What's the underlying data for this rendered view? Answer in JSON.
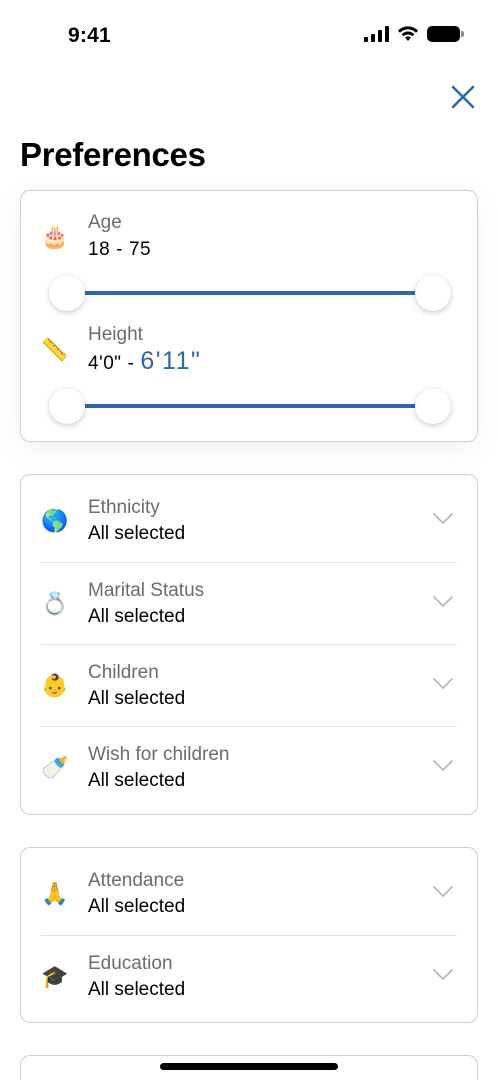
{
  "status_bar": {
    "time": "9:41"
  },
  "header": {
    "title": "Preferences"
  },
  "ranges": [
    {
      "label": "Age",
      "icon": "🎂",
      "icon_name": "birthday-cake-icon",
      "low": "18",
      "separator": "-",
      "high": "75"
    },
    {
      "label": "Height",
      "icon": "📏",
      "icon_name": "ruler-icon",
      "low": "4'0\"",
      "separator": "-",
      "high": "6'11\""
    }
  ],
  "filters_group_1": [
    {
      "label": "Ethnicity",
      "value": "All selected",
      "icon": "🌎",
      "icon_name": "globe-icon"
    },
    {
      "label": "Marital Status",
      "value": "All selected",
      "icon": "💍",
      "icon_name": "ring-icon"
    },
    {
      "label": "Children",
      "value": "All selected",
      "icon": "👶",
      "icon_name": "baby-icon"
    },
    {
      "label": "Wish for children",
      "value": "All selected",
      "icon": "🍼",
      "icon_name": "baby-bottle-icon"
    }
  ],
  "filters_group_2": [
    {
      "label": "Attendance",
      "value": "All selected",
      "icon": "🙏",
      "icon_name": "praying-hands-icon"
    },
    {
      "label": "Education",
      "value": "All selected",
      "icon": "🎓",
      "icon_name": "graduation-cap-icon"
    }
  ],
  "colors": {
    "accent": "#2e67ae",
    "track": "#2e66b1",
    "border": "#cfcfd4"
  }
}
